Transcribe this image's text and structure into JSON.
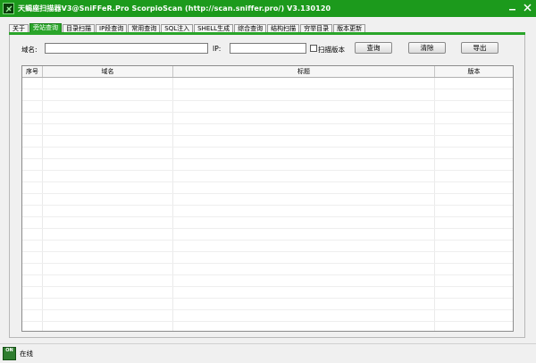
{
  "window": {
    "title": "天蝎座扫描器V3@SniFFeR.Pro  ScorpioScan (http://scan.sniffer.pro/) V3.130120"
  },
  "tabs": [
    {
      "label": "关于",
      "active": false
    },
    {
      "label": "旁站查询",
      "active": true
    },
    {
      "label": "目录扫描",
      "active": false
    },
    {
      "label": "IP段查询",
      "active": false
    },
    {
      "label": "常用查询",
      "active": false
    },
    {
      "label": "SQL注入",
      "active": false
    },
    {
      "label": "SHELL生成",
      "active": false
    },
    {
      "label": "综合查询",
      "active": false
    },
    {
      "label": "结构扫描",
      "active": false
    },
    {
      "label": "穷举目录",
      "active": false
    },
    {
      "label": "版本更新",
      "active": false
    }
  ],
  "form": {
    "domain_label": "域名:",
    "domain_value": "",
    "ip_label": "IP:",
    "ip_value": "",
    "scan_version_label": "扫描版本",
    "scan_version_checked": false,
    "query_button": "查询",
    "clear_button": "清除",
    "export_button": "导出"
  },
  "table": {
    "columns": [
      "序号",
      "域名",
      "标题",
      "版本"
    ],
    "rows": []
  },
  "status": {
    "icon": "ON",
    "text": "在线"
  },
  "colors": {
    "accent": "#2aa52a",
    "titlebar": "#1c9a1c"
  },
  "icons": {
    "app": "scorpion-icon",
    "minimize": "minimize-icon",
    "close": "close-icon",
    "status": "online-icon"
  }
}
